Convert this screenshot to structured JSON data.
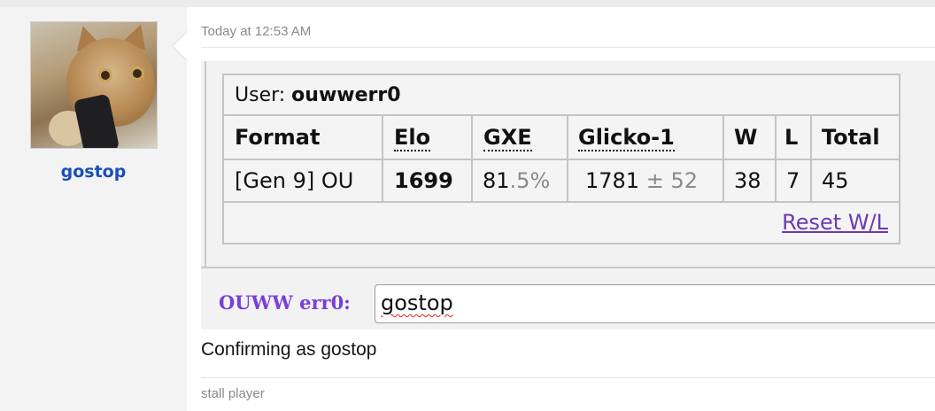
{
  "post": {
    "author": "gostop",
    "timestamp": "Today at 12:53 AM",
    "body_text": "Confirming as gostop",
    "signature": "stall player"
  },
  "stats": {
    "user_label": "User:",
    "username": "ouwwerr0",
    "headers": {
      "format": "Format",
      "elo": "Elo",
      "gxe": "GXE",
      "glicko": "Glicko-1",
      "w": "W",
      "l": "L",
      "total": "Total"
    },
    "row": {
      "format": "[Gen 9] OU",
      "elo": "1699",
      "gxe_main": "81",
      "gxe_frac": ".5%",
      "glicko_main": "1781",
      "glicko_dev": "± 52",
      "w": "38",
      "l": "7",
      "total": "45"
    },
    "reset_link": "Reset W/L"
  },
  "chat": {
    "label": "OUWW err0:",
    "input_value": "gostop"
  },
  "colors": {
    "username": "#1a4fb5",
    "chat_label": "#7a3fd8",
    "link": "#6b3ab2"
  }
}
